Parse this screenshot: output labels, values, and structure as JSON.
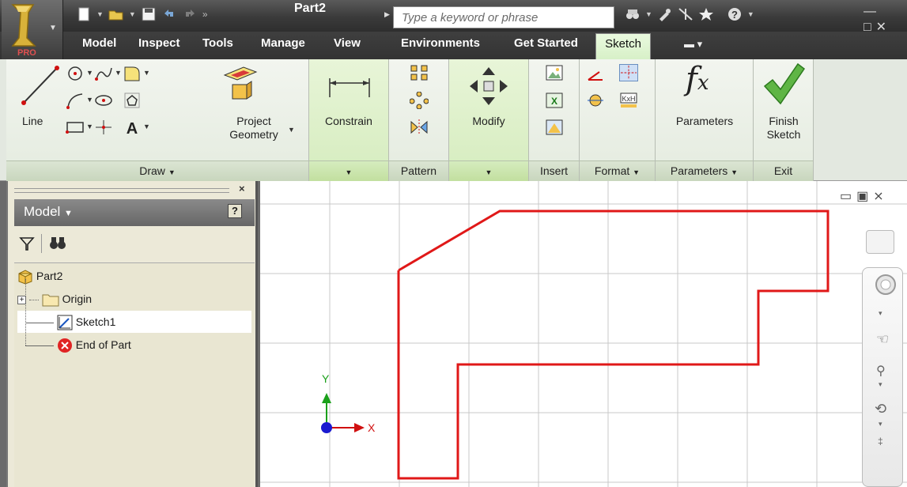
{
  "window": {
    "title": "Part2",
    "search_placeholder": "Type a keyword or phrase",
    "app_badge": "PRO"
  },
  "tabs": [
    "Model",
    "Inspect",
    "Tools",
    "Manage",
    "View",
    "Environments",
    "Get Started",
    "Sketch"
  ],
  "active_tab": "Sketch",
  "ribbon": {
    "draw": {
      "line_label": "Line",
      "project_geometry_label": "Project\nGeometry",
      "panel_label": "Draw"
    },
    "constrain": {
      "label": "Constrain"
    },
    "pattern": {
      "panel_label": "Pattern"
    },
    "modify": {
      "label": "Modify"
    },
    "insert": {
      "panel_label": "Insert"
    },
    "format": {
      "panel_label": "Format"
    },
    "parameters": {
      "label": "Parameters",
      "panel_label": "Parameters"
    },
    "exit": {
      "label": "Finish\nSketch",
      "panel_label": "Exit"
    }
  },
  "browser": {
    "header": "Model",
    "nodes": [
      "Part2",
      "Origin",
      "Sketch1",
      "End of Part"
    ]
  },
  "canvas": {
    "axis_x": "X",
    "axis_y": "Y",
    "sketch_color": "#e01818"
  },
  "colors": {
    "accent_green": "#d5ecbe",
    "axis_green": "#1aa01a",
    "axis_red": "#d01010",
    "origin_blue": "#1a1ad0"
  }
}
